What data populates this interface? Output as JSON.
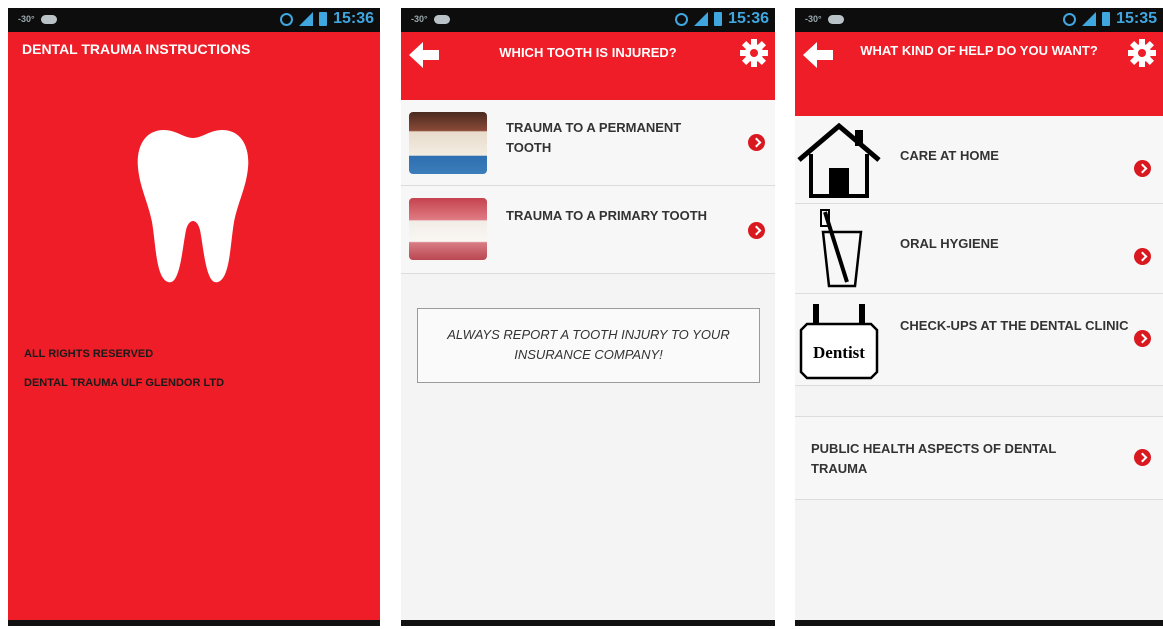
{
  "screens": [
    {
      "status": {
        "time": "15:36",
        "temp": "-30°"
      },
      "app_title": "DENTAL TRAUMA INSTRUCTIONS",
      "rights": "ALL RIGHTS RESERVED",
      "company": "DENTAL TRAUMA ULF GLENDOR LTD"
    },
    {
      "status": {
        "time": "15:36",
        "temp": "-30°"
      },
      "header": {
        "title": "WHICH TOOTH IS INJURED?"
      },
      "items": [
        {
          "label": "TRAUMA TO A PERMANENT TOOTH"
        },
        {
          "label": "TRAUMA TO A PRIMARY TOOTH"
        }
      ],
      "notice": "ALWAYS REPORT A TOOTH INJURY TO YOUR INSURANCE COMPANY!"
    },
    {
      "status": {
        "time": "15:35",
        "temp": "-30°"
      },
      "header": {
        "title": "WHAT KIND OF HELP DO YOU WANT?"
      },
      "items": [
        {
          "label": "CARE AT HOME",
          "icon": "house-icon"
        },
        {
          "label": "ORAL HYGIENE",
          "icon": "toothbrush-glass-icon"
        },
        {
          "label": "CHECK-UPS AT THE DENTAL CLINIC",
          "icon": "dentist-sign-icon",
          "sign_text": "Dentist"
        },
        {
          "label": "PUBLIC HEALTH ASPECTS OF DENTAL TRAUMA"
        }
      ]
    }
  ],
  "colors": {
    "brand_red": "#ee1d27",
    "chevron_red": "#d9181f",
    "status_blue": "#3fa6df"
  }
}
